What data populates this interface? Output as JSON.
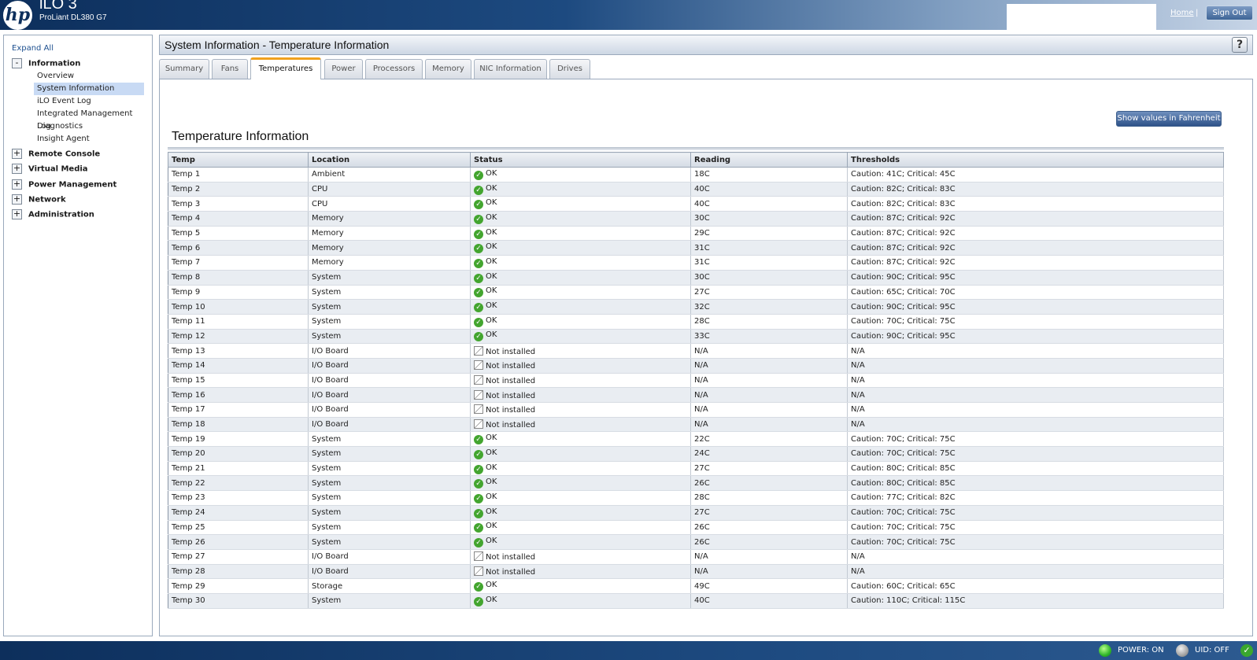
{
  "header": {
    "logo_text": "hp",
    "title": "iLO 3",
    "server_model": "ProLiant DL380 G7",
    "home_link": "Home",
    "separator": "|",
    "sign_out": "Sign Out"
  },
  "nav": {
    "expand_all": "Expand All",
    "sections": [
      {
        "label": "Information",
        "toggle": "-",
        "items": [
          "Overview",
          "System Information",
          "iLO Event Log",
          "Integrated Management Log",
          "Diagnostics",
          "Insight Agent"
        ],
        "active_item": "System Information"
      },
      {
        "label": "Remote Console",
        "toggle": "+"
      },
      {
        "label": "Virtual Media",
        "toggle": "+"
      },
      {
        "label": "Power Management",
        "toggle": "+"
      },
      {
        "label": "Network",
        "toggle": "+"
      },
      {
        "label": "Administration",
        "toggle": "+"
      }
    ]
  },
  "panel": {
    "title": "System Information - Temperature Information",
    "help": "?"
  },
  "tabs": [
    "Summary",
    "Fans",
    "Temperatures",
    "Power",
    "Processors",
    "Memory",
    "NIC Information",
    "Drives"
  ],
  "active_tab": "Temperatures",
  "temperature": {
    "fahrenheit_button": "Show values in Fahrenheit",
    "heading": "Temperature Information",
    "columns": [
      "Temp",
      "Location",
      "Status",
      "Reading",
      "Thresholds"
    ],
    "rows": [
      [
        "Temp 1",
        "Ambient",
        "OK",
        "18C",
        "Caution: 41C; Critical: 45C"
      ],
      [
        "Temp 2",
        "CPU",
        "OK",
        "40C",
        "Caution: 82C; Critical: 83C"
      ],
      [
        "Temp 3",
        "CPU",
        "OK",
        "40C",
        "Caution: 82C; Critical: 83C"
      ],
      [
        "Temp 4",
        "Memory",
        "OK",
        "30C",
        "Caution: 87C; Critical: 92C"
      ],
      [
        "Temp 5",
        "Memory",
        "OK",
        "29C",
        "Caution: 87C; Critical: 92C"
      ],
      [
        "Temp 6",
        "Memory",
        "OK",
        "31C",
        "Caution: 87C; Critical: 92C"
      ],
      [
        "Temp 7",
        "Memory",
        "OK",
        "31C",
        "Caution: 87C; Critical: 92C"
      ],
      [
        "Temp 8",
        "System",
        "OK",
        "30C",
        "Caution: 90C; Critical: 95C"
      ],
      [
        "Temp 9",
        "System",
        "OK",
        "27C",
        "Caution: 65C; Critical: 70C"
      ],
      [
        "Temp 10",
        "System",
        "OK",
        "32C",
        "Caution: 90C; Critical: 95C"
      ],
      [
        "Temp 11",
        "System",
        "OK",
        "28C",
        "Caution: 70C; Critical: 75C"
      ],
      [
        "Temp 12",
        "System",
        "OK",
        "33C",
        "Caution: 90C; Critical: 95C"
      ],
      [
        "Temp 13",
        "I/O Board",
        "Not installed",
        "N/A",
        "N/A"
      ],
      [
        "Temp 14",
        "I/O Board",
        "Not installed",
        "N/A",
        "N/A"
      ],
      [
        "Temp 15",
        "I/O Board",
        "Not installed",
        "N/A",
        "N/A"
      ],
      [
        "Temp 16",
        "I/O Board",
        "Not installed",
        "N/A",
        "N/A"
      ],
      [
        "Temp 17",
        "I/O Board",
        "Not installed",
        "N/A",
        "N/A"
      ],
      [
        "Temp 18",
        "I/O Board",
        "Not installed",
        "N/A",
        "N/A"
      ],
      [
        "Temp 19",
        "System",
        "OK",
        "22C",
        "Caution: 70C; Critical: 75C"
      ],
      [
        "Temp 20",
        "System",
        "OK",
        "24C",
        "Caution: 70C; Critical: 75C"
      ],
      [
        "Temp 21",
        "System",
        "OK",
        "27C",
        "Caution: 80C; Critical: 85C"
      ],
      [
        "Temp 22",
        "System",
        "OK",
        "26C",
        "Caution: 80C; Critical: 85C"
      ],
      [
        "Temp 23",
        "System",
        "OK",
        "28C",
        "Caution: 77C; Critical: 82C"
      ],
      [
        "Temp 24",
        "System",
        "OK",
        "27C",
        "Caution: 70C; Critical: 75C"
      ],
      [
        "Temp 25",
        "System",
        "OK",
        "26C",
        "Caution: 70C; Critical: 75C"
      ],
      [
        "Temp 26",
        "System",
        "OK",
        "26C",
        "Caution: 70C; Critical: 75C"
      ],
      [
        "Temp 27",
        "I/O Board",
        "Not installed",
        "N/A",
        "N/A"
      ],
      [
        "Temp 28",
        "I/O Board",
        "Not installed",
        "N/A",
        "N/A"
      ],
      [
        "Temp 29",
        "Storage",
        "OK",
        "49C",
        "Caution: 60C; Critical: 65C"
      ],
      [
        "Temp 30",
        "System",
        "OK",
        "40C",
        "Caution: 110C; Critical: 115C"
      ]
    ]
  },
  "footer": {
    "power_status": "POWER: ON",
    "uid_status": "UID: OFF",
    "power_led_color": "#2fb52a",
    "uid_led_color": "#a4a4a4"
  }
}
